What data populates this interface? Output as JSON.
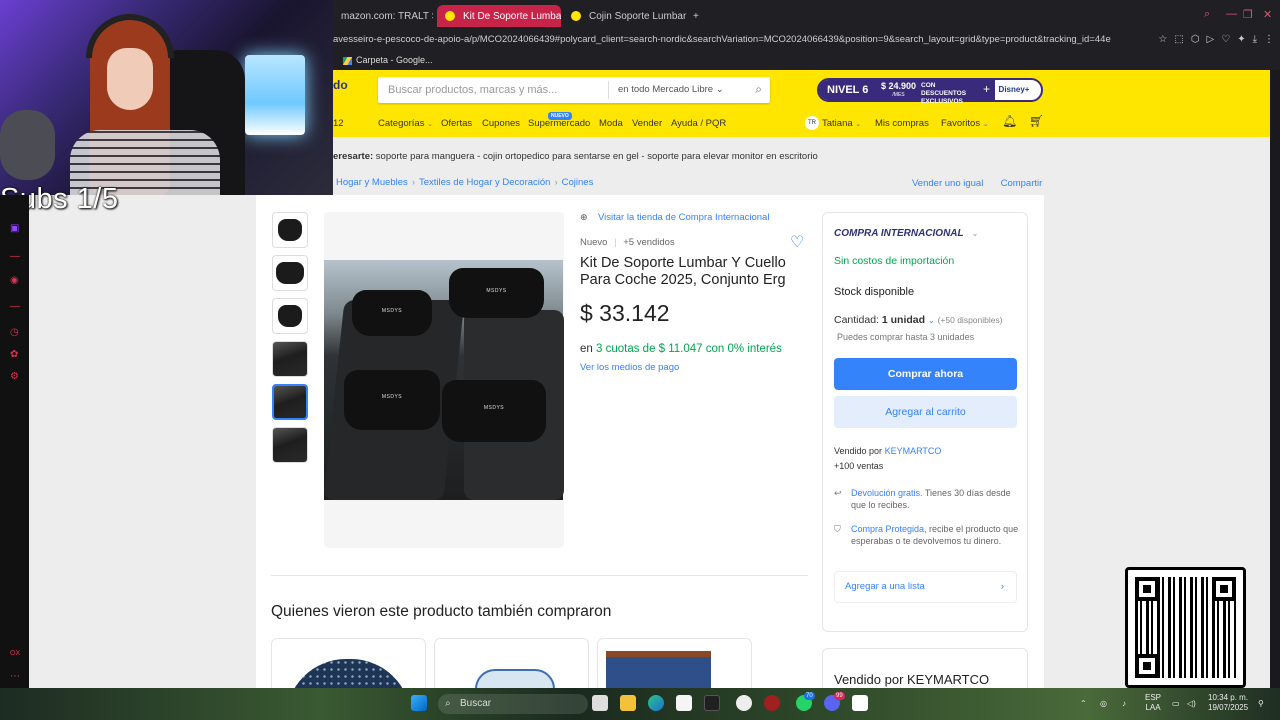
{
  "browser": {
    "tabs": [
      {
        "label": "mazon.com: TRALT Silla",
        "active": false
      },
      {
        "label": "Kit De Soporte Lumbar Y",
        "active": true
      },
      {
        "label": "Cojin Soporte Lumbar Orto",
        "active": false
      }
    ],
    "new_tab": "+",
    "url": "avesseiro-e-pescoco-de-apoio-a/p/MCO2024066439#polycard_client=search-nordic&searchVariation=MCO2024066439&position=9&search_layout=grid&type=product&tracking_id=44e",
    "bookmark": "Carpeta - Google..."
  },
  "ml": {
    "logo_fragment": "do",
    "search_placeholder": "Buscar productos, marcas y más...",
    "search_scope": "en todo Mercado Libre",
    "promo": {
      "level": "NIVEL 6",
      "price": "$ 24.900",
      "price_unit": "/MES",
      "desc": "CON DESCUENTOS EXCLUSIVOS",
      "partner": "Disney+"
    },
    "nav": {
      "partial": "12",
      "categories": "Categorías",
      "offers": "Ofertas",
      "coupons": "Cupones",
      "supermarket": "Supermercado",
      "fashion": "Moda",
      "sell": "Vender",
      "help": "Ayuda / PQR",
      "badge_new": "NUEVO"
    },
    "user": {
      "initials": "TR",
      "name": "Tatiana",
      "purchases": "Mis compras",
      "favorites": "Favoritos"
    }
  },
  "related": {
    "label": "eresarte:",
    "items": "soporte para manguera - cojin ortopedico para sentarse en gel - soporte para elevar monitor en escritorio"
  },
  "breadcrumb": {
    "items": [
      "Hogar y Muebles",
      "Textiles de Hogar y Decoración",
      "Cojines"
    ],
    "sell_same": "Vender uno igual",
    "share": "Compartir"
  },
  "product": {
    "store_link": "Visitar la tienda de Compra Internacional",
    "condition": "Nuevo",
    "sold": "+5 vendidos",
    "title": "Kit De Soporte Lumbar Y Cuello Para Coche 2025, Conjunto Erg",
    "price": "$ 33.142",
    "installments_prefix": "en",
    "installments": "3 cuotas de $ 11.047 con 0% interés",
    "payment_link": "Ver los medios de pago",
    "brand_on_pillow": "MSDYS"
  },
  "buybox": {
    "intl": "COMPRA INTERNACIONAL",
    "no_import": "Sin costos de importación",
    "stock": "Stock disponible",
    "qty_label": "Cantidad:",
    "qty_value": "1 unidad",
    "available": "(+50 disponibles)",
    "max_buy": "Puedes comprar hasta 3 unidades",
    "buy_now": "Comprar ahora",
    "add_cart": "Agregar al carrito",
    "sold_by_prefix": "Vendido por",
    "seller": "KEYMARTCO",
    "sales": "+100 ventas",
    "returns_link": "Devolución gratis.",
    "returns_text": " Tienes 30 días desde que lo recibes.",
    "protected_link": "Compra Protegida",
    "protected_text": ", recibe el producto que esperabas o te devolvemos tu dinero.",
    "add_list": "Agregar a una lista",
    "seller_card": "Vendido por KEYMARTCO"
  },
  "recommendations": {
    "title": "Quienes vieron este producto también compraron"
  },
  "overlay": {
    "subs": "Subs 1/5"
  },
  "taskbar": {
    "search": "Buscar",
    "lang": "ESP",
    "layout": "LAA",
    "time": "10:34 p. m.",
    "date": "19/07/2025",
    "whatsapp_badge": "70",
    "discord_badge": "99"
  },
  "colors": {
    "ml_yellow": "#ffe600",
    "ml_blue": "#3483fa",
    "green": "#00a650",
    "active_tab": "#c8244a"
  }
}
